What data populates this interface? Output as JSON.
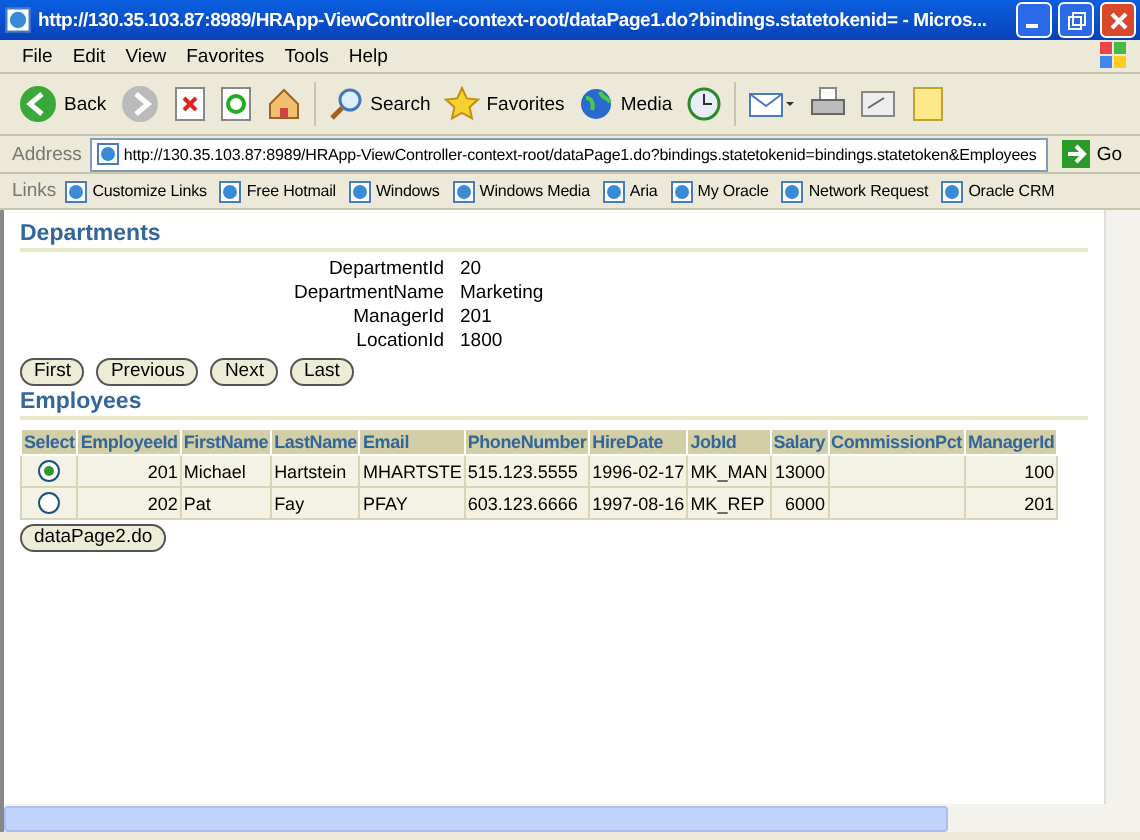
{
  "window": {
    "title": "http://130.35.103.87:8989/HRApp-ViewController-context-root/dataPage1.do?bindings.statetokenid= - Micros..."
  },
  "menu": [
    "File",
    "Edit",
    "View",
    "Favorites",
    "Tools",
    "Help"
  ],
  "toolbar": [
    {
      "kind": "back",
      "label": "Back"
    },
    {
      "kind": "forward"
    },
    {
      "kind": "stop"
    },
    {
      "kind": "refresh"
    },
    {
      "kind": "home"
    },
    {
      "kind": "search",
      "label": "Search"
    },
    {
      "kind": "favorites",
      "label": "Favorites"
    },
    {
      "kind": "media",
      "label": "Media"
    },
    {
      "kind": "history"
    },
    {
      "kind": "mail"
    },
    {
      "kind": "print"
    },
    {
      "kind": "edit"
    },
    {
      "kind": "note"
    }
  ],
  "address": {
    "label": "Address",
    "value": "http://130.35.103.87:8989/HRApp-ViewController-context-root/dataPage1.do?bindings.statetokenid=bindings.statetoken&Employees",
    "go": "Go"
  },
  "links": {
    "label": "Links",
    "items": [
      "Customize Links",
      "Free Hotmail",
      "Windows",
      "Windows Media",
      "Aria",
      "My Oracle",
      "Network Request",
      "Oracle CRM"
    ]
  },
  "departments": {
    "heading": "Departments",
    "fields": [
      {
        "label": "DepartmentId",
        "value": "20"
      },
      {
        "label": "DepartmentName",
        "value": "Marketing"
      },
      {
        "label": "ManagerId",
        "value": "201"
      },
      {
        "label": "LocationId",
        "value": "1800"
      }
    ],
    "buttons": [
      "First",
      "Previous",
      "Next",
      "Last"
    ]
  },
  "employees": {
    "heading": "Employees",
    "columns": [
      "Select",
      "EmployeeId",
      "FirstName",
      "LastName",
      "Email",
      "PhoneNumber",
      "HireDate",
      "JobId",
      "Salary",
      "CommissionPct",
      "ManagerId"
    ],
    "rows": [
      {
        "selected": true,
        "cells": [
          "",
          "201",
          "Michael",
          "Hartstein",
          "MHARTSTE",
          "515.123.5555",
          "1996-02-17",
          "MK_MAN",
          "13000",
          "",
          "100"
        ]
      },
      {
        "selected": false,
        "cells": [
          "",
          "202",
          "Pat",
          "Fay",
          "PFAY",
          "603.123.6666",
          "1997-08-16",
          "MK_REP",
          "6000",
          "",
          "201"
        ]
      }
    ],
    "button": "dataPage2.do"
  }
}
